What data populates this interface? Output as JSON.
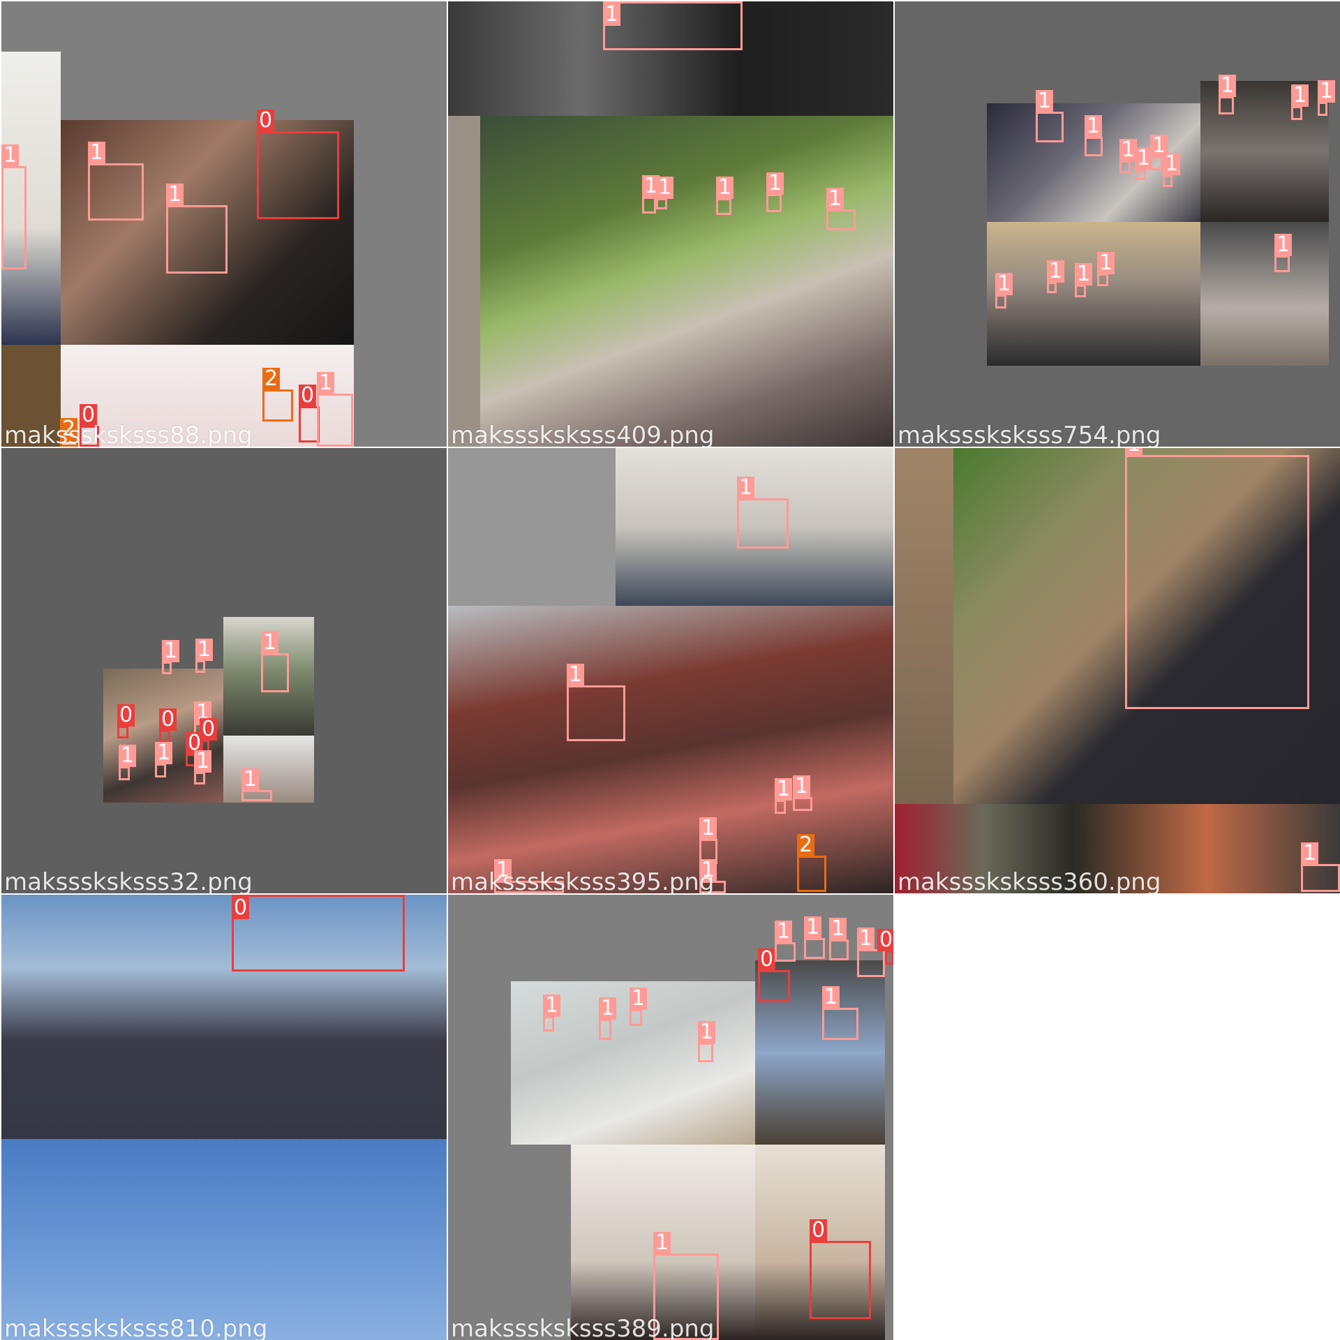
{
  "colors": {
    "class0": "#ea3d3d",
    "class1": "#ff9b97",
    "class2": "#ea6c12",
    "tile_bg": "#7f7f7f"
  },
  "tiles": [
    {
      "filename": "maksssksksss88.png"
    },
    {
      "filename": "maksssksksss409.png"
    },
    {
      "filename": "maksssksksss754.png"
    },
    {
      "filename": "maksssksksss32.png"
    },
    {
      "filename": "maksssksksss395.png"
    },
    {
      "filename": "maksssksksss360.png"
    },
    {
      "filename": "maksssksksss810.png"
    },
    {
      "filename": "maksssksksss389.png"
    }
  ],
  "labels": {
    "zero": "0",
    "one": "1",
    "two": "2"
  }
}
